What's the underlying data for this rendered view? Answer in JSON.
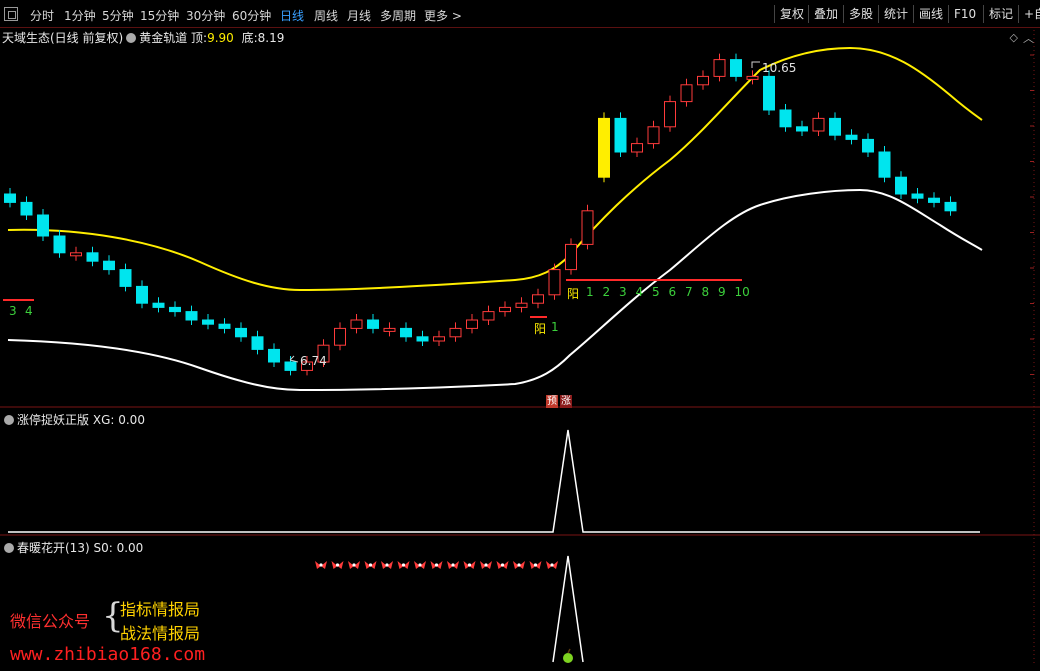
{
  "toolbar": {
    "timeframes": [
      "分时",
      "1分钟",
      "5分钟",
      "15分钟",
      "30分钟",
      "60分钟",
      "日线",
      "周线",
      "月线",
      "多周期",
      "更多 >"
    ],
    "active_timeframe": "日线",
    "right_buttons": [
      "复权",
      "叠加",
      "多股",
      "统计",
      "画线",
      "F10",
      "标记",
      "+自"
    ]
  },
  "main_pane": {
    "stock_title": "天域生态(日线 前复权)",
    "indicator_name": "黄金轨道",
    "top_label": "顶:",
    "top_value": "9.90",
    "bottom_label": "底:",
    "bottom_value": "8.19",
    "high_marker": "10.65",
    "low_marker": "6.74",
    "yang_label_1": "阳",
    "yang_count_1": "1",
    "yang_label_2": "阳",
    "counts_left": [
      "3",
      "4"
    ],
    "counts_right": [
      "1",
      "2",
      "3",
      "4",
      "5",
      "6",
      "7",
      "8",
      "9",
      "10"
    ],
    "signal_pre": "预",
    "signal_up": "涨"
  },
  "pane2": {
    "title": "涨停捉妖正版",
    "field": "XG:",
    "value": "0.00"
  },
  "pane3": {
    "title": "春暖花开(13)",
    "field": "S0:",
    "value": "0.00"
  },
  "watermark": {
    "left": "微信公众号",
    "line1": "指标情报局",
    "line2": "战法情报局",
    "url": "www.zhibiao168.com"
  },
  "colors": {
    "up": "#ff3b3b",
    "down": "#00e5ee",
    "upper_band": "#ffee00",
    "lower_band": "#ffffff",
    "active_tab": "#3aa0ff"
  },
  "chart_data": {
    "type": "candlestick",
    "series": [
      {
        "values": [
          8.9,
          8.75,
          8.5,
          8.3,
          8.3,
          8.2,
          8.1,
          7.9,
          7.7,
          7.65,
          7.6,
          7.5,
          7.45,
          7.4,
          7.3,
          7.15,
          7.0,
          6.9,
          7.0,
          7.2,
          7.4,
          7.5,
          7.4,
          7.4,
          7.3,
          7.25,
          7.3,
          7.4,
          7.5,
          7.6,
          7.65,
          7.7,
          7.8,
          8.1,
          8.4,
          8.8,
          9.9,
          9.5,
          9.6,
          9.8,
          10.1,
          10.3,
          10.4,
          10.6,
          10.4,
          10.4,
          10.0,
          9.8,
          9.75,
          9.9,
          9.7,
          9.65,
          9.5,
          9.2,
          9.0,
          8.95,
          8.9,
          8.8
        ]
      }
    ]
  }
}
